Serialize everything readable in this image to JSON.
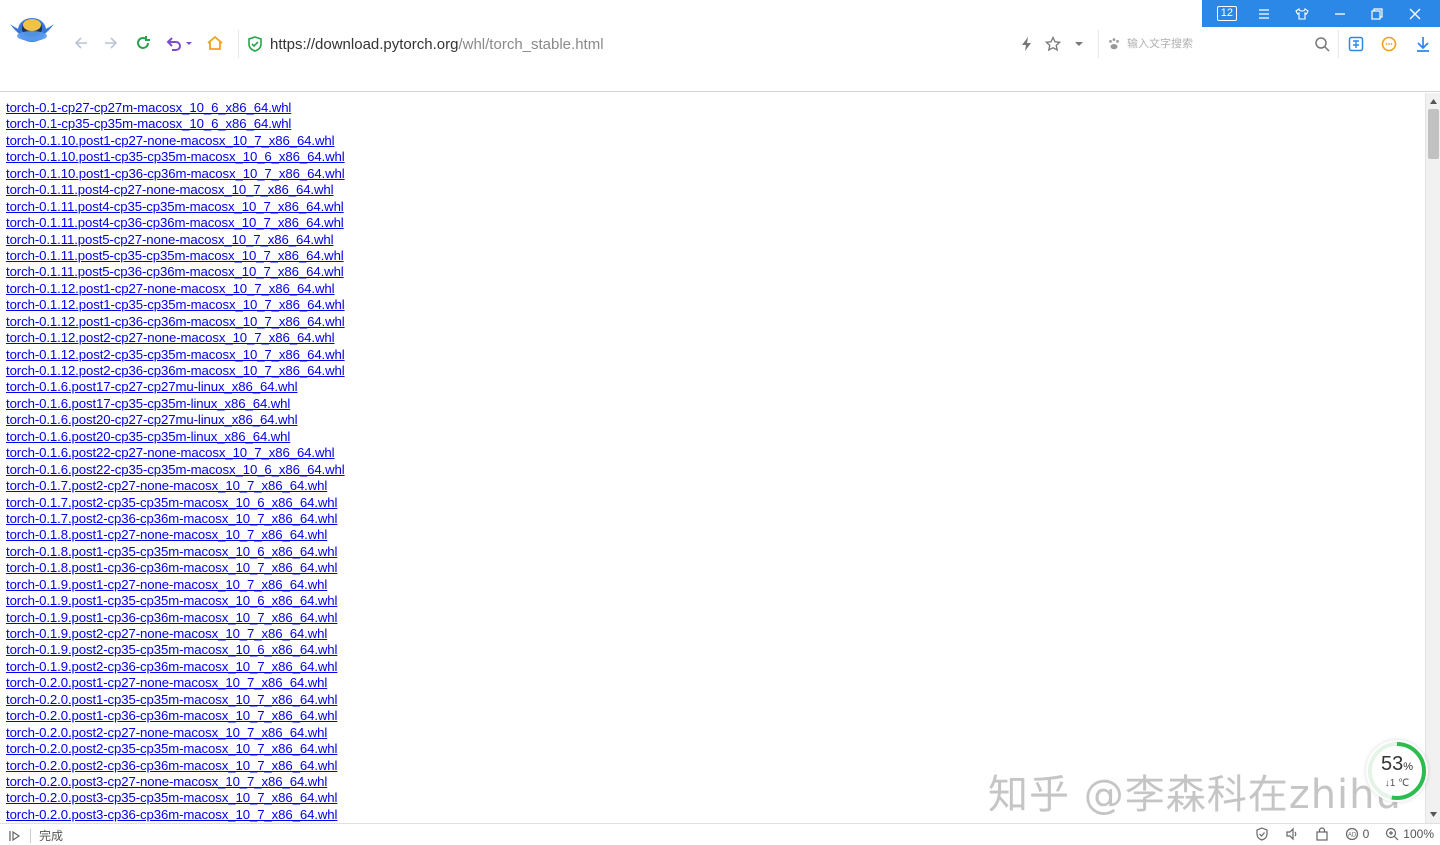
{
  "toolbar": {
    "url_prefix": "https://",
    "url_host": "download.pytorch.org",
    "url_path": "/whl/torch_stable.html",
    "search_placeholder": "输入文字搜索"
  },
  "window_controls": {
    "tab_count": "12"
  },
  "links": [
    "torch-0.1-cp27-cp27m-macosx_10_6_x86_64.whl",
    "torch-0.1-cp35-cp35m-macosx_10_6_x86_64.whl",
    "torch-0.1.10.post1-cp27-none-macosx_10_7_x86_64.whl",
    "torch-0.1.10.post1-cp35-cp35m-macosx_10_6_x86_64.whl",
    "torch-0.1.10.post1-cp36-cp36m-macosx_10_7_x86_64.whl",
    "torch-0.1.11.post4-cp27-none-macosx_10_7_x86_64.whl",
    "torch-0.1.11.post4-cp35-cp35m-macosx_10_7_x86_64.whl",
    "torch-0.1.11.post4-cp36-cp36m-macosx_10_7_x86_64.whl",
    "torch-0.1.11.post5-cp27-none-macosx_10_7_x86_64.whl",
    "torch-0.1.11.post5-cp35-cp35m-macosx_10_7_x86_64.whl",
    "torch-0.1.11.post5-cp36-cp36m-macosx_10_7_x86_64.whl",
    "torch-0.1.12.post1-cp27-none-macosx_10_7_x86_64.whl",
    "torch-0.1.12.post1-cp35-cp35m-macosx_10_7_x86_64.whl",
    "torch-0.1.12.post1-cp36-cp36m-macosx_10_7_x86_64.whl",
    "torch-0.1.12.post2-cp27-none-macosx_10_7_x86_64.whl",
    "torch-0.1.12.post2-cp35-cp35m-macosx_10_7_x86_64.whl",
    "torch-0.1.12.post2-cp36-cp36m-macosx_10_7_x86_64.whl",
    "torch-0.1.6.post17-cp27-cp27mu-linux_x86_64.whl",
    "torch-0.1.6.post17-cp35-cp35m-linux_x86_64.whl",
    "torch-0.1.6.post20-cp27-cp27mu-linux_x86_64.whl",
    "torch-0.1.6.post20-cp35-cp35m-linux_x86_64.whl",
    "torch-0.1.6.post22-cp27-none-macosx_10_7_x86_64.whl",
    "torch-0.1.6.post22-cp35-cp35m-macosx_10_6_x86_64.whl",
    "torch-0.1.7.post2-cp27-none-macosx_10_7_x86_64.whl",
    "torch-0.1.7.post2-cp35-cp35m-macosx_10_6_x86_64.whl",
    "torch-0.1.7.post2-cp36-cp36m-macosx_10_7_x86_64.whl",
    "torch-0.1.8.post1-cp27-none-macosx_10_7_x86_64.whl",
    "torch-0.1.8.post1-cp35-cp35m-macosx_10_6_x86_64.whl",
    "torch-0.1.8.post1-cp36-cp36m-macosx_10_7_x86_64.whl",
    "torch-0.1.9.post1-cp27-none-macosx_10_7_x86_64.whl",
    "torch-0.1.9.post1-cp35-cp35m-macosx_10_6_x86_64.whl",
    "torch-0.1.9.post1-cp36-cp36m-macosx_10_7_x86_64.whl",
    "torch-0.1.9.post2-cp27-none-macosx_10_7_x86_64.whl",
    "torch-0.1.9.post2-cp35-cp35m-macosx_10_6_x86_64.whl",
    "torch-0.1.9.post2-cp36-cp36m-macosx_10_7_x86_64.whl",
    "torch-0.2.0.post1-cp27-none-macosx_10_7_x86_64.whl",
    "torch-0.2.0.post1-cp35-cp35m-macosx_10_7_x86_64.whl",
    "torch-0.2.0.post1-cp36-cp36m-macosx_10_7_x86_64.whl",
    "torch-0.2.0.post2-cp27-none-macosx_10_7_x86_64.whl",
    "torch-0.2.0.post2-cp35-cp35m-macosx_10_7_x86_64.whl",
    "torch-0.2.0.post2-cp36-cp36m-macosx_10_7_x86_64.whl",
    "torch-0.2.0.post3-cp27-none-macosx_10_7_x86_64.whl",
    "torch-0.2.0.post3-cp35-cp35m-macosx_10_7_x86_64.whl",
    "torch-0.2.0.post3-cp36-cp36m-macosx_10_7_x86_64.whl"
  ],
  "speed_widget": {
    "percent": "53",
    "percent_unit": "%",
    "sub": "↓1 ℃",
    "fraction": 0.53
  },
  "watermark": "知乎 @李森科在zhihu",
  "statusbar": {
    "status_text": "完成",
    "adblock_count": "0",
    "zoom": "100%"
  },
  "colors": {
    "link": "#0000ee",
    "accent": "#2b88e6",
    "speed_ring": "#2dbd4e"
  }
}
